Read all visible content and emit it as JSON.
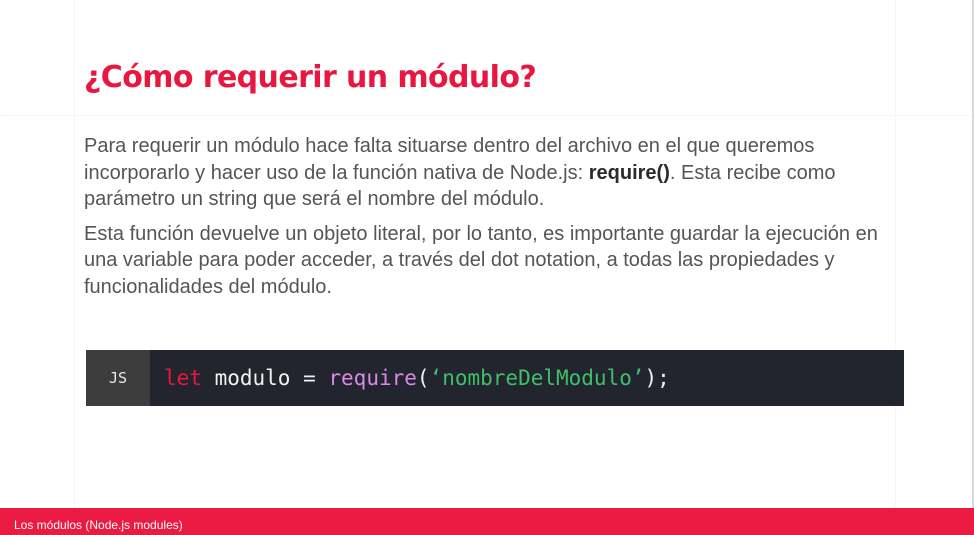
{
  "slide": {
    "title": "¿Cómo requerir un módulo?",
    "paragraph_1": {
      "before_bold": "Para requerir un módulo hace falta situarse dentro del archivo en el que queremos incorporarlo y hacer uso de la función nativa de Node.js: ",
      "bold": "require()",
      "after_bold": ". Esta recibe como parámetro un string que será el nombre del módulo."
    },
    "paragraph_2": "Esta función devuelve un objeto literal, por lo tanto, es importante guardar la ejecución en una variable para poder acceder, a través del dot notation, a todas las propiedades y funcionalidades del módulo."
  },
  "code": {
    "language": "JS",
    "tokens": {
      "keyword": "let",
      "space_1": " ",
      "identifier": "modulo",
      "operator": " = ",
      "function": "require",
      "open_paren": "(",
      "string": "‘nombreDelModulo’",
      "close": ");"
    },
    "colors": {
      "keyword": "#e8173f",
      "identifier": "#f2f2f2",
      "function": "#d98ae6",
      "string": "#3fbf6c",
      "background": "#22252d",
      "label_background": "#3d3d3d"
    }
  },
  "footer": {
    "label": "Los módulos (Node.js modules)",
    "color": "#eb1a42"
  },
  "theme": {
    "accent": "#e8173f",
    "text": "#555555"
  }
}
